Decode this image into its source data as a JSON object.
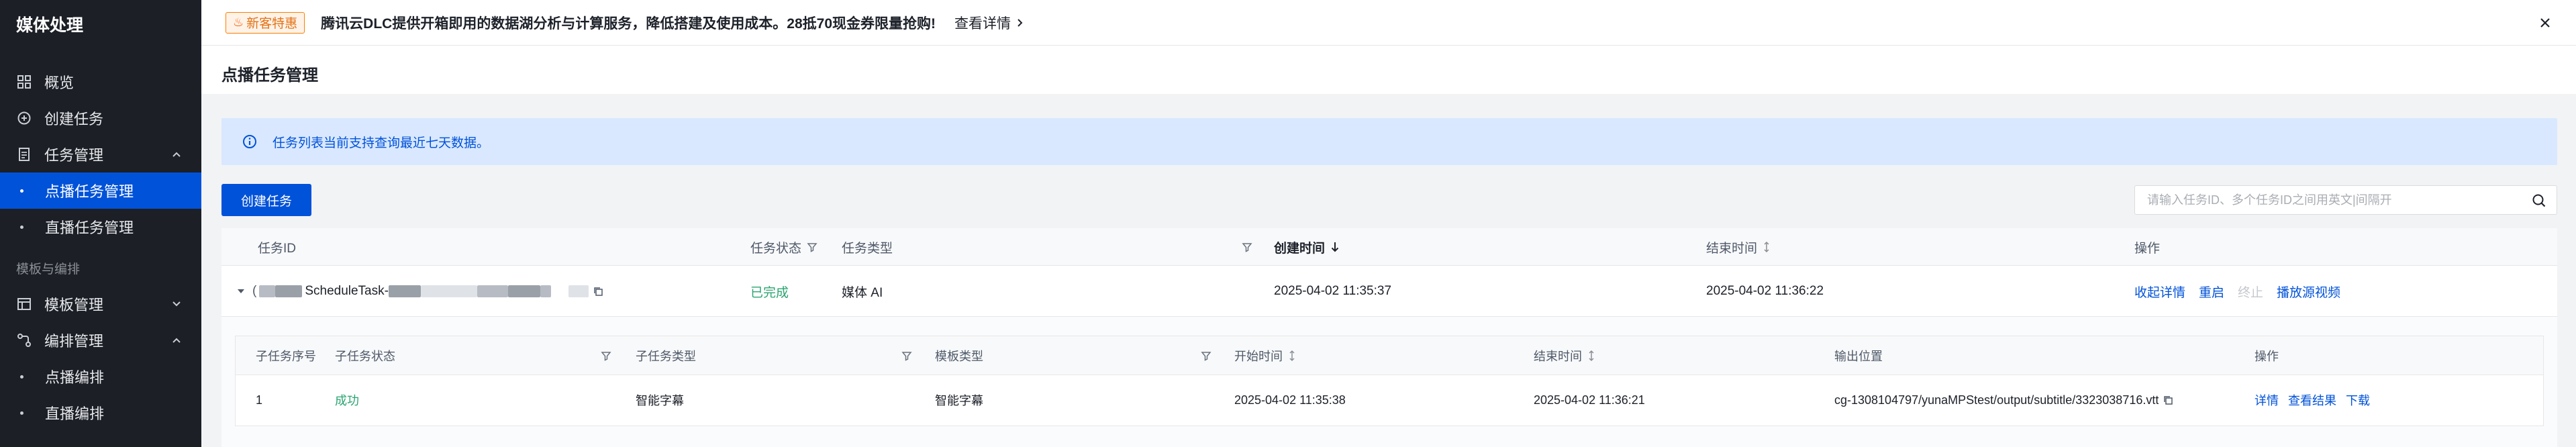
{
  "sidebar": {
    "title": "媒体处理",
    "items": [
      {
        "label": "概览"
      },
      {
        "label": "创建任务"
      },
      {
        "label": "任务管理"
      },
      {
        "label": "点播任务管理"
      },
      {
        "label": "直播任务管理"
      },
      {
        "label": "模板与编排"
      },
      {
        "label": "模板管理"
      },
      {
        "label": "编排管理"
      },
      {
        "label": "点播编排"
      },
      {
        "label": "直播编排"
      }
    ],
    "active": "点播任务管理"
  },
  "notice": {
    "badge": "新客特惠",
    "text": "腾讯云DLC提供开箱即用的数据湖分析与计算服务，降低搭建及使用成本。28抵70现金券限量抢购!",
    "link": "查看详情"
  },
  "page": {
    "title": "点播任务管理"
  },
  "alert": {
    "text": "任务列表当前支持查询最近七天数据。"
  },
  "toolbar": {
    "create_label": "创建任务",
    "search_placeholder": "请输入任务ID、多个任务ID之间用英文|间隔开"
  },
  "table": {
    "columns": [
      "任务ID",
      "任务状态",
      "任务类型",
      "创建时间",
      "结束时间",
      "操作"
    ],
    "rows": [
      {
        "task_id_mid": "ScheduleTask-",
        "status": "已完成",
        "type": "媒体 AI",
        "created": "2025-04-02 11:35:37",
        "ended": "2025-04-02 11:36:22",
        "actions": [
          "收起详情",
          "重启",
          "终止",
          "播放源视频"
        ]
      }
    ]
  },
  "subtable": {
    "columns": [
      "子任务序号",
      "子任务状态",
      "子任务类型",
      "模板类型",
      "开始时间",
      "结束时间",
      "输出位置",
      "操作"
    ],
    "rows": [
      {
        "index": "1",
        "status": "成功",
        "type": "智能字幕",
        "template": "智能字幕",
        "start": "2025-04-02 11:35:38",
        "end": "2025-04-02 11:36:21",
        "output": "cg-1308104797/yunaMPStest/output/subtitle/3323038716.vtt",
        "actions": [
          "详情",
          "查看结果",
          "下载"
        ]
      }
    ]
  },
  "colors": {
    "primary": "#0052d9",
    "sidebar_bg": "#1c1f26",
    "success": "#2ba471",
    "alert_bg": "#d9e8ff",
    "badge_orange": "#e37318"
  }
}
